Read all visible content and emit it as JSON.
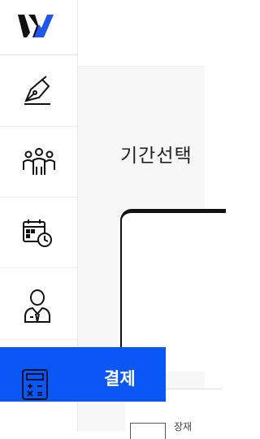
{
  "nav": {
    "items": [
      {
        "icon": "pen-nib-icon"
      },
      {
        "icon": "team-people-icon"
      },
      {
        "icon": "calendar-clock-icon"
      },
      {
        "icon": "person-suit-icon"
      }
    ],
    "active_item": {
      "icon": "calculator-icon",
      "label": "결제"
    }
  },
  "main": {
    "section_title": "기간선택",
    "sub_text": "장재"
  },
  "colors": {
    "accent": "#0a57f5",
    "logo_black": "#111111",
    "logo_blue": "#1f57e6"
  }
}
